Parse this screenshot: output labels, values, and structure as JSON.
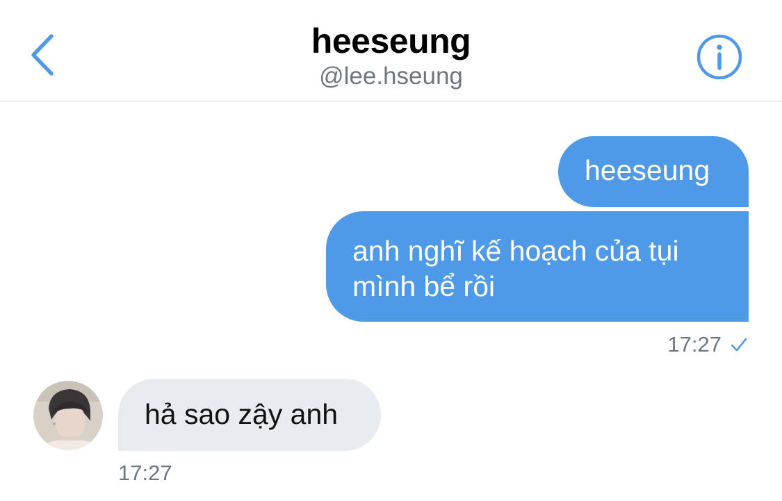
{
  "header": {
    "title": "heeseung",
    "handle": "@lee.hseung",
    "back_icon": "chevron-left-icon",
    "info_icon": "info-circle-icon"
  },
  "messages": [
    {
      "direction": "outgoing",
      "text": "heeseung"
    },
    {
      "direction": "outgoing",
      "text": "anh nghĩ kế hoạch của tụi mình bể rồi",
      "time": "17:27",
      "status_icon": "checkmark-icon"
    },
    {
      "direction": "incoming",
      "text": "hả sao zậy anh",
      "time": "17:27",
      "avatar_icon": "user-avatar"
    }
  ],
  "colors": {
    "accent": "#4f9ae8",
    "incoming_bubble": "#e8ebef",
    "secondary_text": "#6e7780",
    "divider": "#cfd4d9"
  }
}
